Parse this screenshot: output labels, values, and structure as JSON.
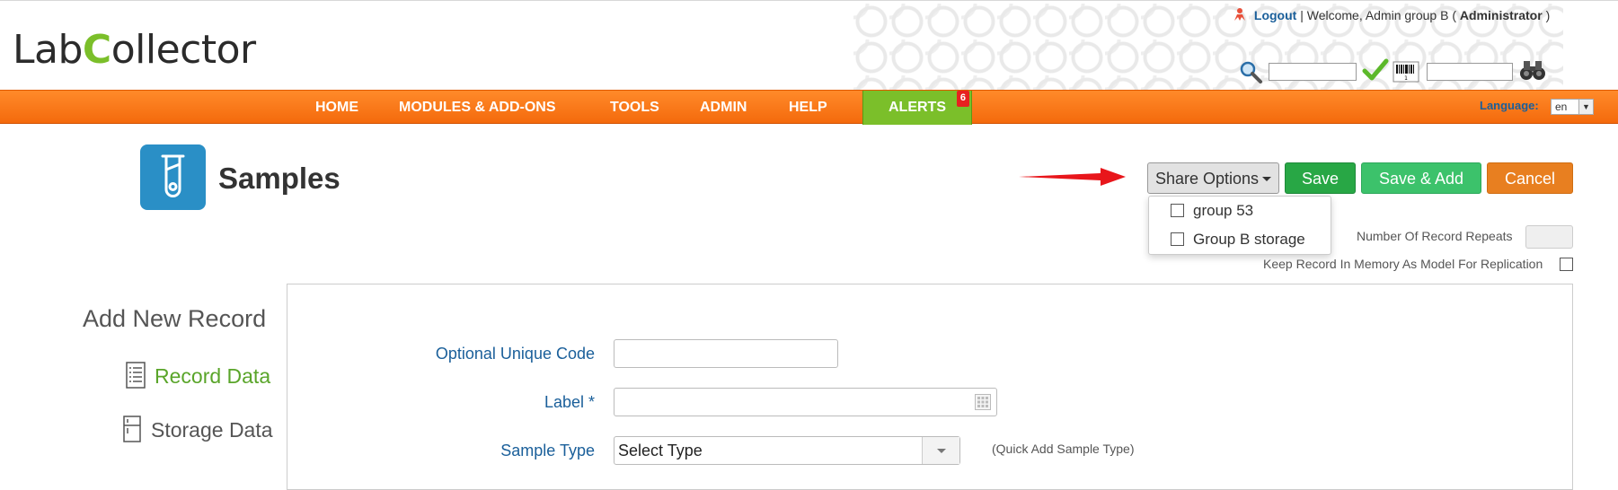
{
  "header": {
    "logo_text_1": "Lab",
    "logo_text_2": "ollector",
    "logout": "Logout",
    "welcome": "| Welcome, Admin group B (",
    "role": "Administrator",
    "close_paren": ")"
  },
  "nav": {
    "items": [
      "HOME",
      "MODULES & ADD-ONS",
      "TOOLS",
      "ADMIN",
      "HELP"
    ],
    "alerts_label": "ALERTS",
    "alerts_count": "6",
    "language_label": "Language:",
    "language_value": "en"
  },
  "page": {
    "title": "Samples"
  },
  "toolbar": {
    "share_label": "Share Options",
    "save_label": "Save",
    "save_add_label": "Save & Add",
    "cancel_label": "Cancel"
  },
  "share_dropdown": {
    "options": [
      "group 53",
      "Group B storage"
    ]
  },
  "options": {
    "repeats_label": "Number Of Record Repeats",
    "keep_label": "Keep Record In Memory As Model For Replication"
  },
  "sidebar": {
    "title": "Add New Record",
    "record_data": "Record Data",
    "storage_data": "Storage Data"
  },
  "form": {
    "unique_code_label": "Optional Unique Code",
    "label_label": "Label *",
    "sample_type_label": "Sample Type",
    "sample_type_value": "Select Type",
    "quick_add": "(Quick Add Sample Type)"
  },
  "colors": {
    "nav_orange": "#f46a0c",
    "alerts_green": "#7bbf2a",
    "save_green": "#28a745",
    "cancel_orange": "#e87f20",
    "link_blue": "#1a5f9a",
    "module_blue": "#2a8fc6"
  }
}
